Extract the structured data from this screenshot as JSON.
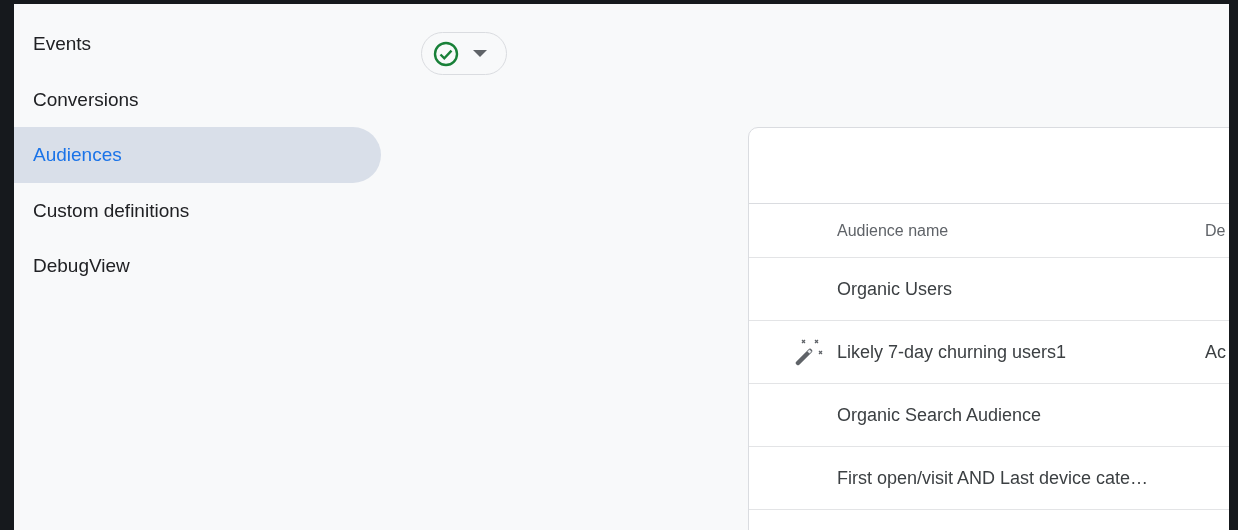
{
  "sidebar": {
    "items": [
      {
        "label": "Events",
        "selected": false
      },
      {
        "label": "Conversions",
        "selected": false
      },
      {
        "label": "Audiences",
        "selected": true
      },
      {
        "label": "Custom definitions",
        "selected": false
      },
      {
        "label": "DebugView",
        "selected": false
      }
    ]
  },
  "status_button": {
    "checked": true
  },
  "table": {
    "columns": [
      "Audience name",
      "De"
    ],
    "rows": [
      {
        "kind": "plain",
        "cells": [
          "Organic Users"
        ]
      },
      {
        "kind": "predictive",
        "cells": [
          "Likely 7-day churning users1",
          "Ac"
        ]
      },
      {
        "kind": "plain",
        "cells": [
          "Organic Search Audience"
        ]
      },
      {
        "kind": "plain",
        "cells": [
          "First open/visit AND Last device cate…"
        ]
      }
    ]
  }
}
